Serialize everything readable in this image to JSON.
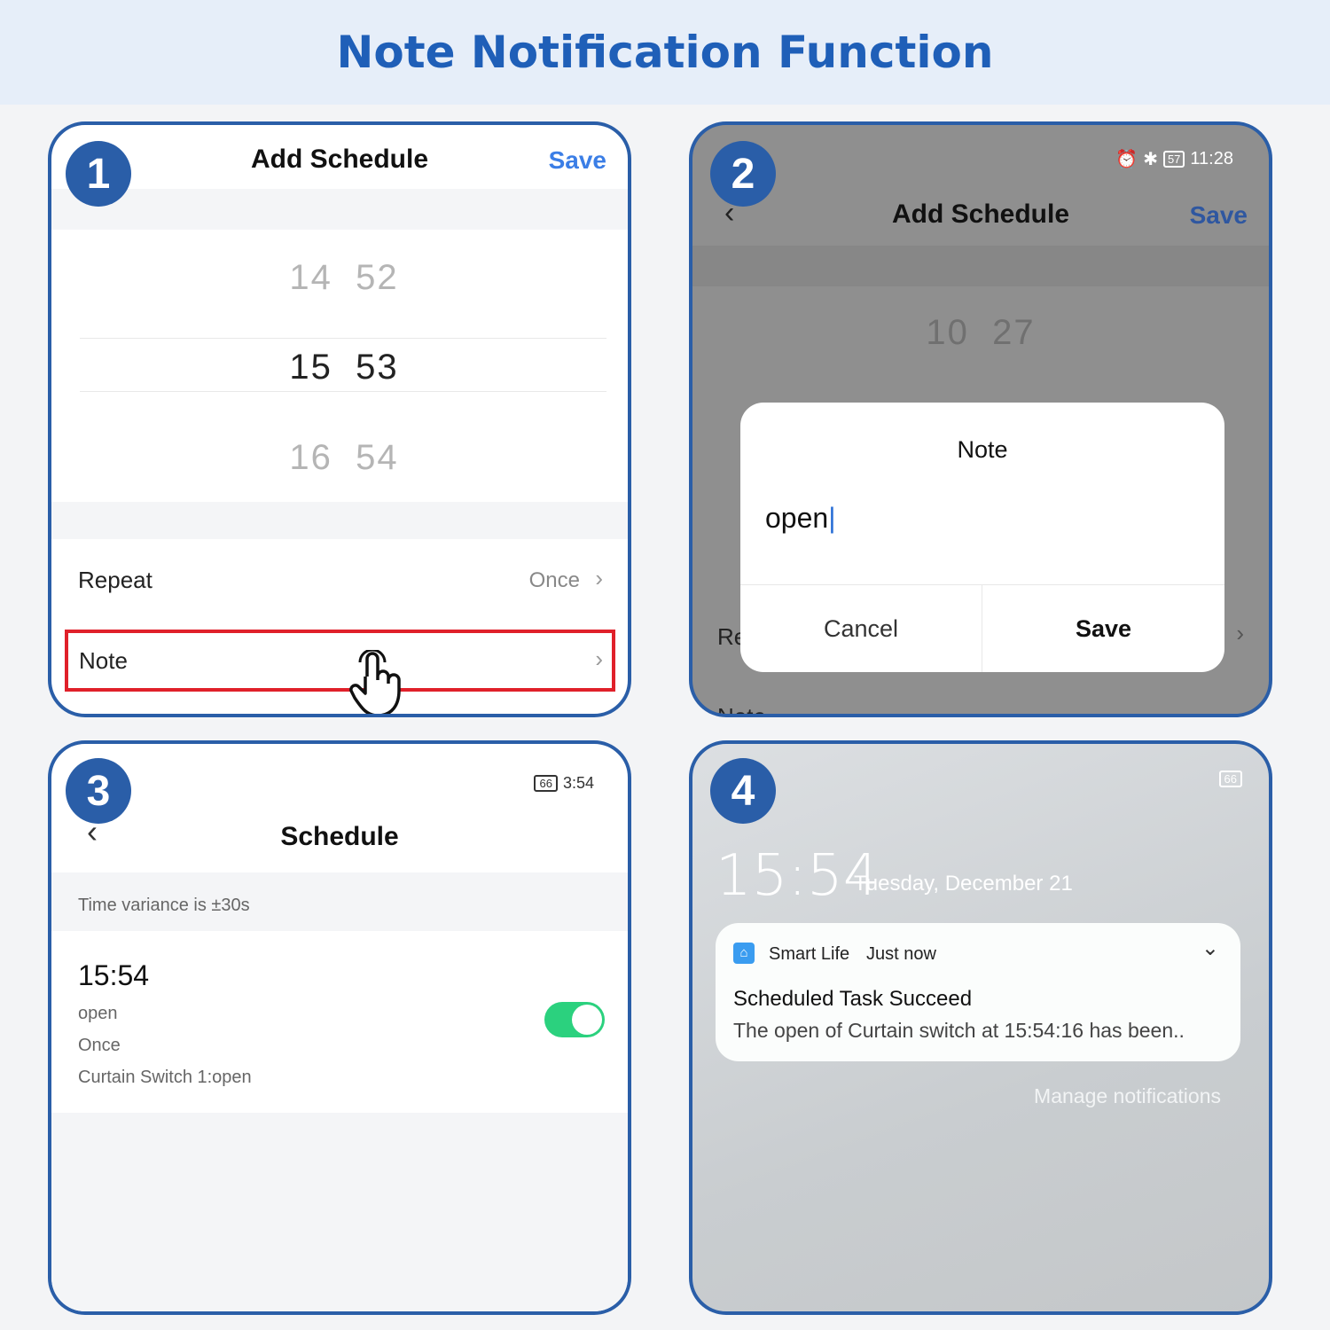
{
  "banner": {
    "title": "Note Notification Function"
  },
  "step1": {
    "badge": "1",
    "title": "Add Schedule",
    "save": "Save",
    "picker": [
      {
        "hour": "14",
        "minute": "52"
      },
      {
        "hour": "15",
        "minute": "53"
      },
      {
        "hour": "16",
        "minute": "54"
      }
    ],
    "repeat_label": "Repeat",
    "repeat_value": "Once",
    "note_label": "Note",
    "highlight_color": "#e0202a"
  },
  "step2": {
    "badge": "2",
    "status_time": "11:28",
    "battery": "57",
    "title": "Add Schedule",
    "save": "Save",
    "picker": {
      "hour": "10",
      "minute": "27"
    },
    "repeat_partial": "Re",
    "note_partial": "Note",
    "dialog": {
      "title": "Note",
      "input_value": "open",
      "cancel": "Cancel",
      "save": "Save"
    }
  },
  "step3": {
    "badge": "3",
    "battery": "66",
    "status_time": "3:54",
    "title": "Schedule",
    "variance": "Time variance is ±30s",
    "item": {
      "time": "15:54",
      "note": "open",
      "repeat": "Once",
      "action": "Curtain Switch 1:open",
      "enabled": true
    },
    "toggle_color": "#2bd17e"
  },
  "step4": {
    "badge": "4",
    "battery": "66",
    "clock": "15:54",
    "date": "Tuesday, December 21",
    "notification": {
      "app": "Smart Life",
      "when": "Just now",
      "title": "Scheduled Task Succeed",
      "body": "The open of Curtain switch at 15:54:16 has been.."
    },
    "manage": "Manage notifications"
  }
}
